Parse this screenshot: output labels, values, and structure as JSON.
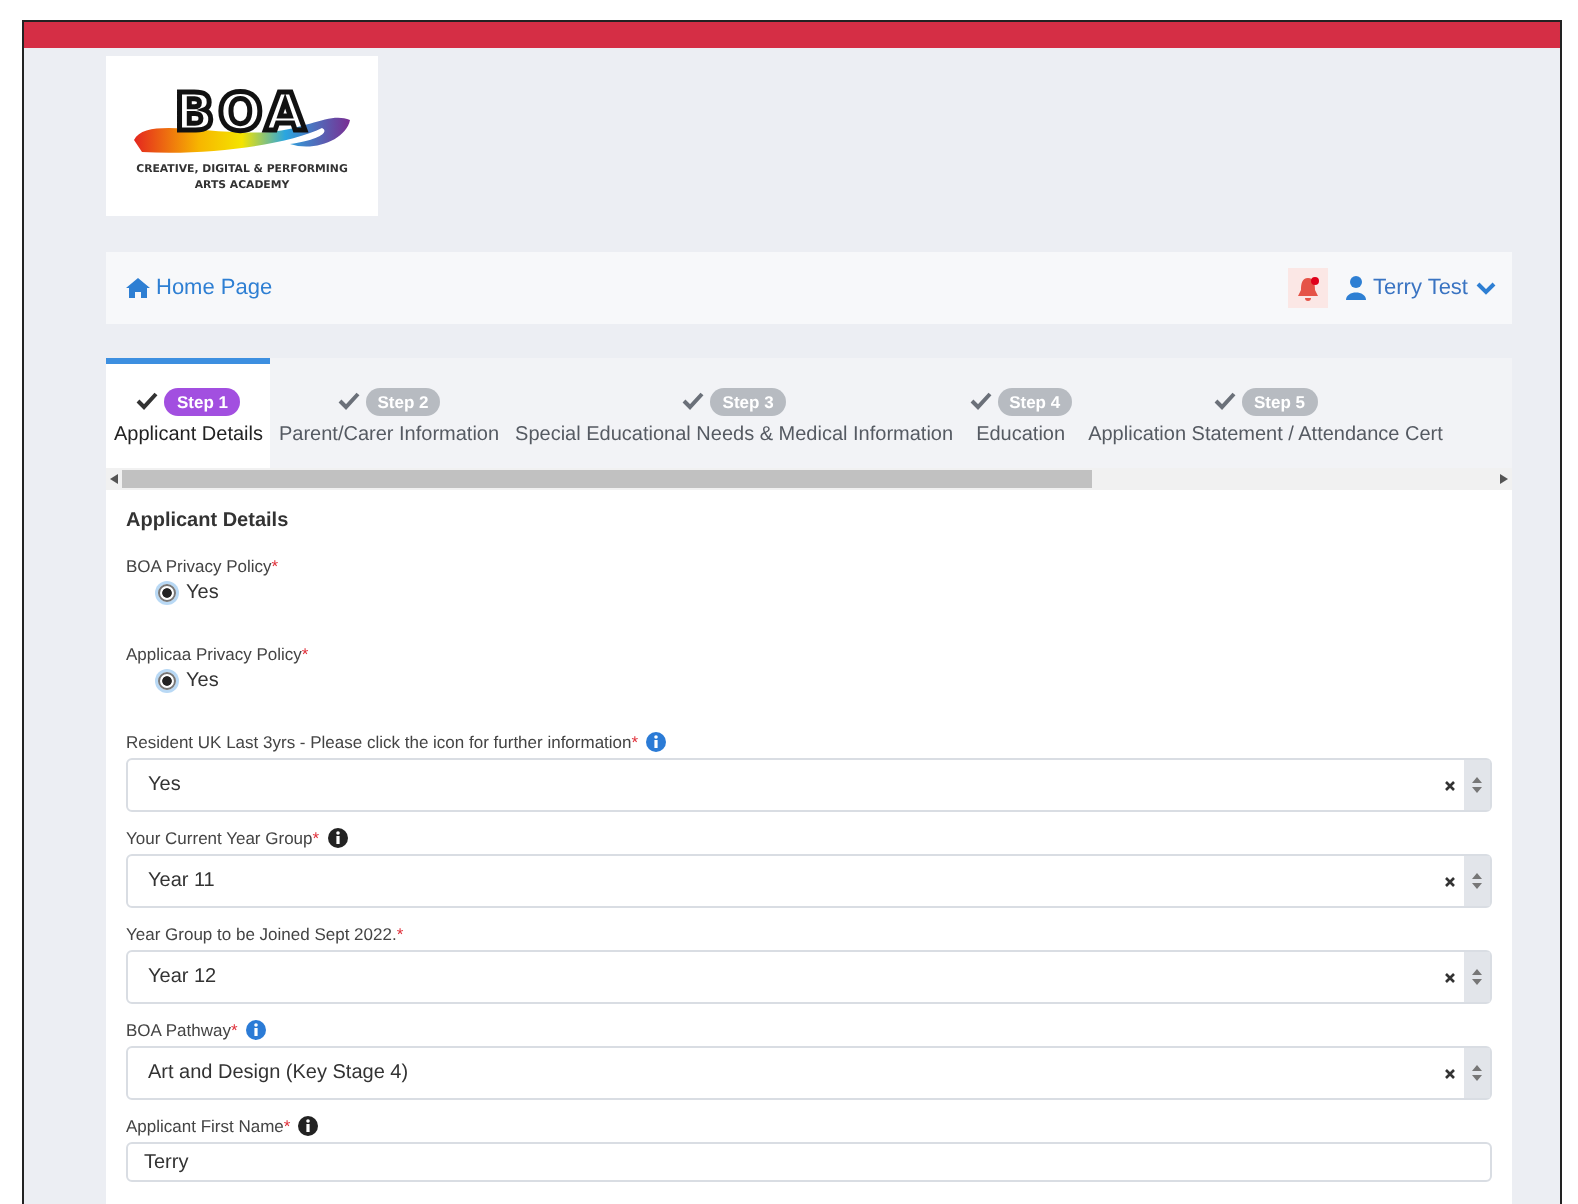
{
  "logo": {
    "wordmark": "BOA",
    "tagline": "CREATIVE, DIGITAL & PERFORMING ARTS ACADEMY"
  },
  "nav": {
    "home_link": "Home Page",
    "notifications": {
      "unread": true
    },
    "user": "Terry Test"
  },
  "tabs": [
    {
      "step": "Step 1",
      "label": "Applicant Details",
      "selected": true
    },
    {
      "step": "Step 2",
      "label": "Parent/Carer Information",
      "selected": false
    },
    {
      "step": "Step 3",
      "label": "Special Educational Needs & Medical Information",
      "selected": false
    },
    {
      "step": "Step 4",
      "label": "Education",
      "selected": false
    },
    {
      "step": "Step 5",
      "label": "Application Statement / Attendance Cert",
      "selected": false
    }
  ],
  "section_title": "Applicant Details",
  "fields": [
    {
      "kind": "radio",
      "label": "BOA Privacy Policy",
      "required_mark": "*",
      "options": [
        {
          "label": "Yes",
          "selected": true
        }
      ]
    },
    {
      "kind": "radio",
      "label": "Applicaa Privacy Policy",
      "required_mark": "*",
      "options": [
        {
          "label": "Yes",
          "selected": true
        }
      ]
    },
    {
      "kind": "select",
      "label": "Resident UK Last 3yrs - Please click the icon for further information",
      "required_mark": "*",
      "info_icon": {
        "color": "#2b7bd6"
      },
      "value": "Yes"
    },
    {
      "kind": "select",
      "label": "Your Current Year Group",
      "required_mark": "*",
      "info_icon": {
        "color": "#222222"
      },
      "value": "Year 11"
    },
    {
      "kind": "select",
      "label": "Year Group to be Joined Sept 2022.",
      "required_mark": "*",
      "value": "Year 12"
    },
    {
      "kind": "select",
      "label": "BOA Pathway",
      "required_mark": "*",
      "info_icon": {
        "color": "#2b7bd6"
      },
      "value": "Art and Design (Key Stage 4)"
    },
    {
      "kind": "text",
      "label": "Applicant First Name",
      "required_mark": "*",
      "info_icon": {
        "color": "#222222"
      },
      "value": "Terry"
    }
  ]
}
